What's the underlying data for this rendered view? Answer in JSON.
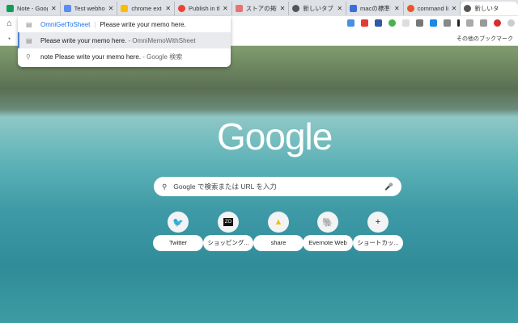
{
  "tabs": [
    {
      "title": "Note - Goog",
      "color": "#0f9d58"
    },
    {
      "title": "Test webhoo",
      "color": "#5b8def"
    },
    {
      "title": "chrome exte",
      "color": "#fbbc05"
    },
    {
      "title": "Publish in th",
      "color": "#ea4335"
    },
    {
      "title": "ストアの掲載",
      "color": "#e57373"
    },
    {
      "title": "新しいタブ",
      "color": "#555555"
    },
    {
      "title": "macの標準ア",
      "color": "#3b6fd6"
    },
    {
      "title": "command li",
      "color": "#e8562a"
    },
    {
      "title": "新しいタ",
      "color": "#555555"
    }
  ],
  "omnibox": {
    "suggestions": [
      {
        "keyword": "OmniGetToSheet",
        "text": "Please write your memo here.",
        "source": ""
      },
      {
        "keyword": "",
        "text": "Please write your memo here.",
        "source": "- OmniMemoWithSheet"
      },
      {
        "keyword": "",
        "text": "note Please write your memo here.",
        "source": "- Google 検索"
      }
    ]
  },
  "bookmarks": {
    "other": "その他のブックマーク"
  },
  "ntp": {
    "logo": "Google",
    "search_placeholder": "Google で検索または URL を入力",
    "shortcuts": [
      {
        "label": "Twitter",
        "icon": "🐦"
      },
      {
        "label": "ショッピング...",
        "icon": "ZO"
      },
      {
        "label": "share",
        "icon": "▲"
      },
      {
        "label": "Evernote Web",
        "icon": "🐘"
      },
      {
        "label": "ショートカッ...",
        "icon": "+"
      }
    ]
  }
}
